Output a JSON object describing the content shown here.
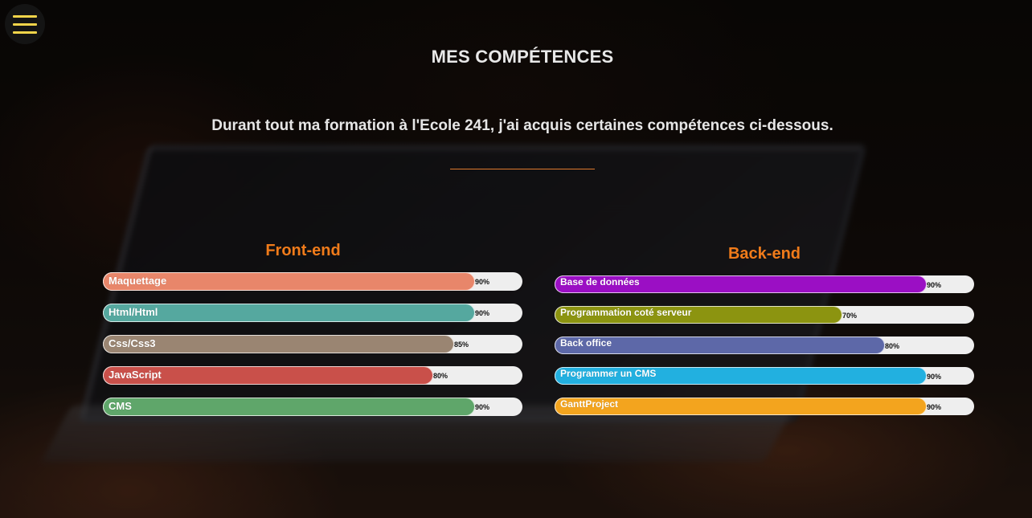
{
  "page": {
    "title": "MES COMPÉTENCES",
    "intro": "Durant tout ma formation à l'Ecole 241, j'ai acquis certaines compétences ci-dessous."
  },
  "colors": {
    "accent": "#f07b1a",
    "menu_icon": "#f3d44a",
    "track": "#eeeeee"
  },
  "front": {
    "title": "Front-end",
    "skills": [
      {
        "label": "Maquettage",
        "percent_text": "90%",
        "level": 90,
        "color": "#e8866a"
      },
      {
        "label": "Html/Html",
        "percent_text": "90%",
        "level": 90,
        "color": "#55a89f"
      },
      {
        "label": "Css/Css3",
        "percent_text": "85%",
        "level": 85,
        "color": "#9a8572"
      },
      {
        "label": "JavaScript",
        "percent_text": "80%",
        "level": 80,
        "color": "#c9504a"
      },
      {
        "label": "CMS",
        "percent_text": "90%",
        "level": 90,
        "color": "#5fa66a"
      }
    ]
  },
  "back": {
    "title": "Back-end",
    "skills": [
      {
        "label": "Base de données",
        "percent_text": "90%",
        "level": 90,
        "color": "#9b0fc4"
      },
      {
        "label": "Programmation coté serveur",
        "percent_text": "70%",
        "level": 70,
        "color": "#8c9410"
      },
      {
        "label": "Back office",
        "percent_text": "80%",
        "level": 80,
        "color": "#5d68a8"
      },
      {
        "label": "Programmer un CMS",
        "percent_text": "90%",
        "level": 90,
        "color": "#22b0e0"
      },
      {
        "label": "GanttProject",
        "percent_text": "90%",
        "level": 90,
        "color": "#f3a41e"
      }
    ]
  }
}
